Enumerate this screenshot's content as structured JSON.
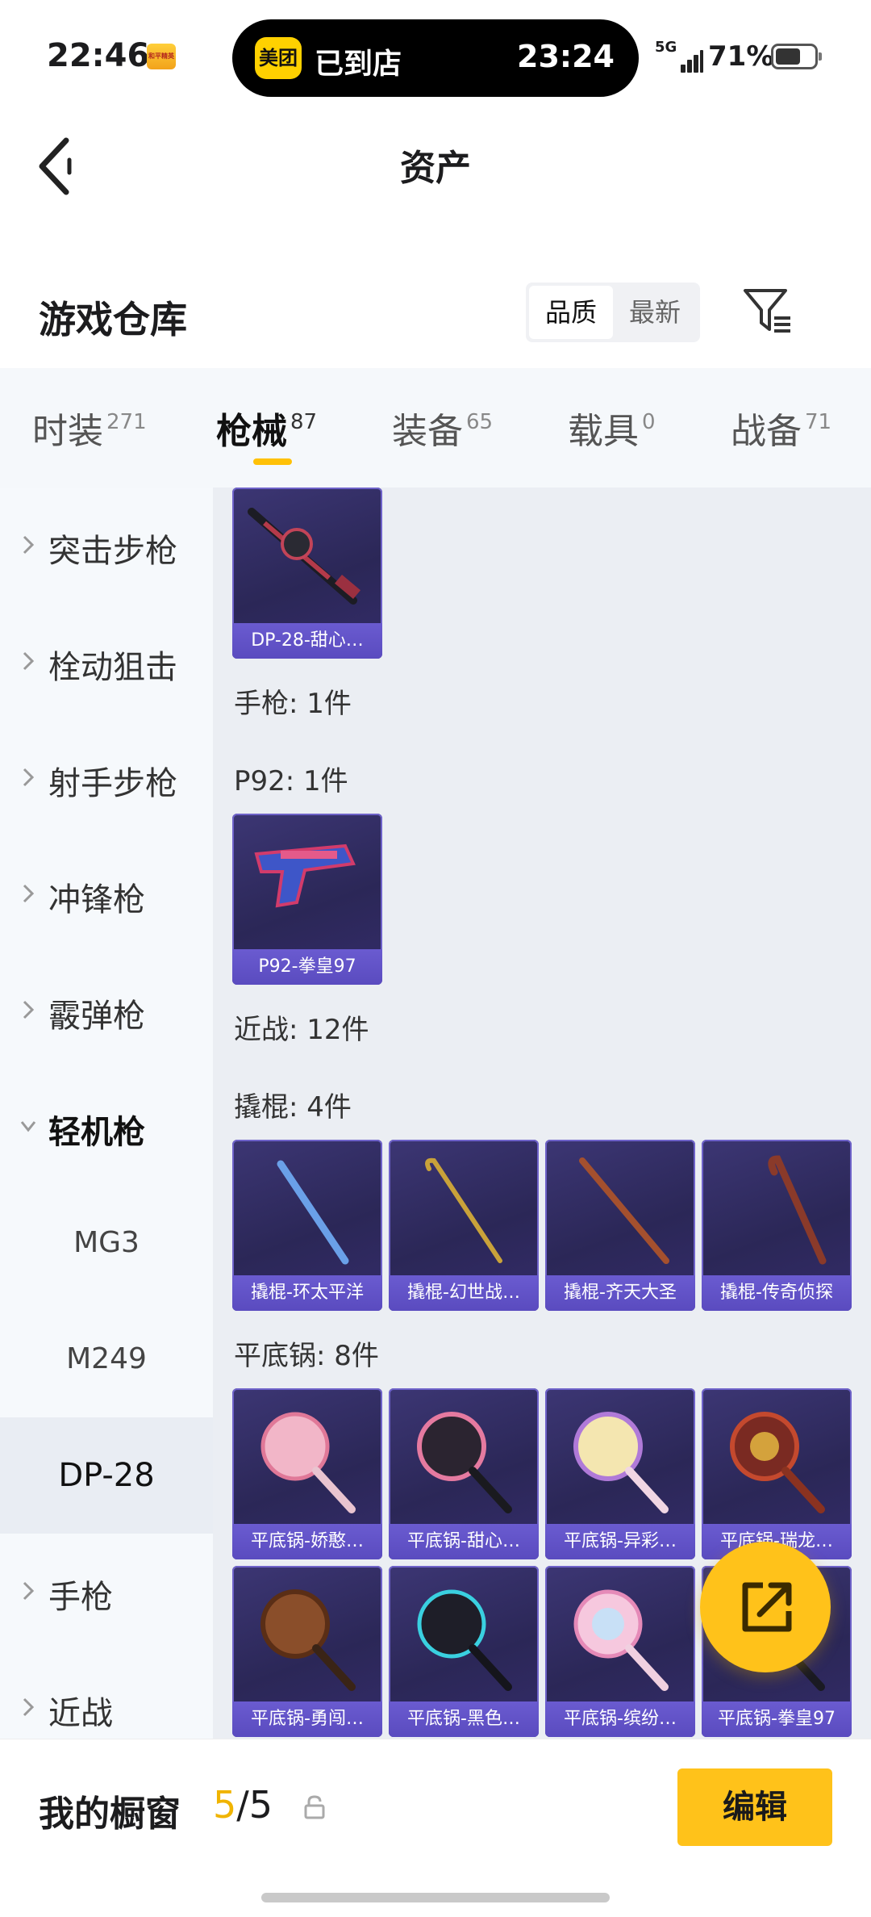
{
  "status_bar": {
    "time": "22:46",
    "app_badge": "和平精英",
    "island_logo": "美团",
    "island_status": "已到店",
    "island_time": "23:24",
    "network": "5G",
    "battery": "71%"
  },
  "header": {
    "title": "资产"
  },
  "warehouse": {
    "title": "游戏仓库",
    "sort_options": [
      "品质",
      "最新"
    ],
    "active_sort": "品质"
  },
  "tabs": [
    {
      "label": "时装",
      "count": "271"
    },
    {
      "label": "枪械",
      "count": "87",
      "active": true
    },
    {
      "label": "装备",
      "count": "65"
    },
    {
      "label": "载具",
      "count": "0"
    },
    {
      "label": "战备",
      "count": "71"
    }
  ],
  "sidebar": {
    "items": [
      {
        "label": "突击步枪"
      },
      {
        "label": "栓动狙击"
      },
      {
        "label": "射手步枪"
      },
      {
        "label": "冲锋枪"
      },
      {
        "label": "霰弹枪"
      },
      {
        "label": "轻机枪",
        "expanded": true
      }
    ],
    "sub_items": [
      "MG3",
      "M249",
      "DP-28"
    ],
    "selected_sub": "DP-28",
    "after_items": [
      {
        "label": "手枪"
      },
      {
        "label": "近战"
      }
    ]
  },
  "content": {
    "dp28_card": "DP-28-甜心…",
    "pistol_section": "手枪: 1件",
    "p92_section": "P92: 1件",
    "p92_card": "P92-拳皇97",
    "melee_section": "近战: 12件",
    "crowbar_section": "撬棍: 4件",
    "crowbar_cards": [
      "撬棍-环太平洋",
      "撬棍-幻世战…",
      "撬棍-齐天大圣",
      "撬棍-传奇侦探"
    ],
    "pan_section": "平底锅: 8件",
    "pan_cards_row1": [
      "平底锅-娇憨…",
      "平底锅-甜心…",
      "平底锅-异彩…",
      "平底锅-瑞龙…"
    ],
    "pan_cards_row2": [
      "平底锅-勇闯…",
      "平底锅-黑色…",
      "平底锅-缤纷…",
      "平底锅-拳皇97"
    ]
  },
  "bottom_bar": {
    "label": "我的橱窗",
    "count_current": "5",
    "count_total": "/5",
    "edit_label": "编辑"
  },
  "colors": {
    "accent": "#ffc21a",
    "card_bg": "#2b2757",
    "card_caption": "#5a4bbf",
    "content_bg": "#ebeef3"
  }
}
